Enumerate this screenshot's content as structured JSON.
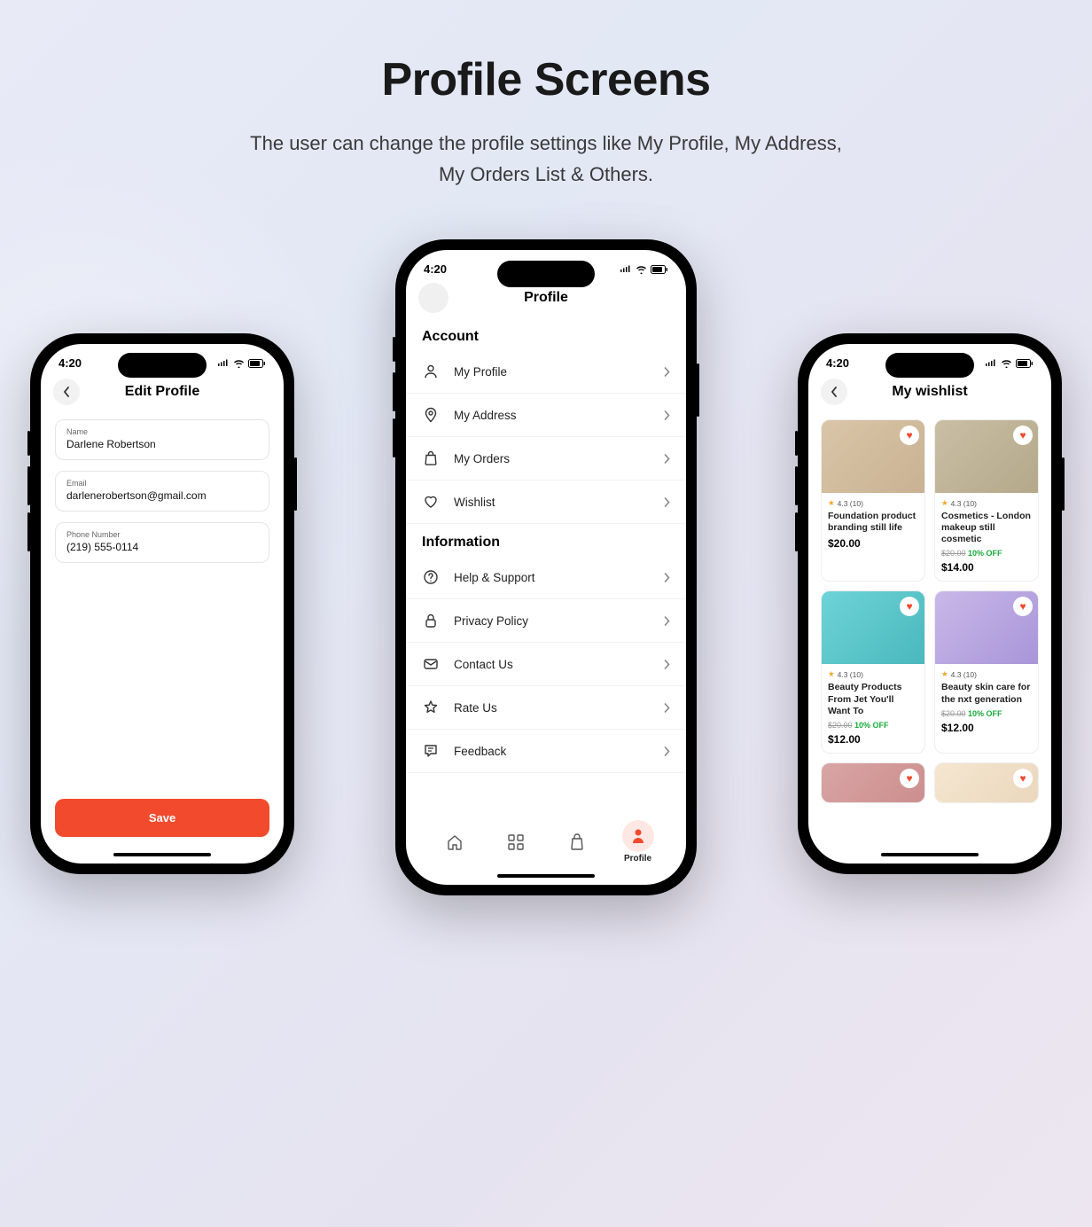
{
  "page": {
    "title": "Profile Screens",
    "subtitle": "The user can change the profile settings like My Profile, My Address, My Orders List & Others."
  },
  "status_time": "4:20",
  "edit_profile": {
    "title": "Edit Profile",
    "fields": {
      "name": {
        "label": "Name",
        "value": "Darlene Robertson"
      },
      "email": {
        "label": "Email",
        "value": "darlenerobertson@gmail.com"
      },
      "phone": {
        "label": "Phone Number",
        "value": "(219) 555-0114"
      }
    },
    "save": "Save"
  },
  "profile": {
    "title": "Profile",
    "sections": [
      {
        "heading": "Account",
        "items": [
          {
            "label": "My Profile",
            "icon": "user-icon"
          },
          {
            "label": "My Address",
            "icon": "location-icon"
          },
          {
            "label": "My Orders",
            "icon": "bag-icon"
          },
          {
            "label": "Wishlist",
            "icon": "heart-icon"
          }
        ]
      },
      {
        "heading": "Information",
        "items": [
          {
            "label": "Help & Support",
            "icon": "help-icon"
          },
          {
            "label": "Privacy Policy",
            "icon": "lock-icon"
          },
          {
            "label": "Contact Us",
            "icon": "mail-icon"
          },
          {
            "label": "Rate Us",
            "icon": "star-icon"
          },
          {
            "label": "Feedback",
            "icon": "feedback-icon"
          }
        ]
      }
    ],
    "bottom_nav": {
      "active_label": "Profile"
    }
  },
  "wishlist": {
    "title": "My wishlist",
    "products": [
      {
        "rating": "4.3 (10)",
        "title": "Foundation product branding still life",
        "old": "",
        "disc": "",
        "price": "$20.00",
        "bg": "linear-gradient(135deg,#d9c5a8,#c9b293)"
      },
      {
        "rating": "4.3 (10)",
        "title": "Cosmetics - London makeup still cosmetic",
        "old": "$20.00",
        "disc": "10% OFF",
        "price": "$14.00",
        "bg": "linear-gradient(135deg,#c9bfa5,#b5a88a)"
      },
      {
        "rating": "4.3 (10)",
        "title": "Beauty Products From Jet You'll Want To",
        "old": "$20.00",
        "disc": "10% OFF",
        "price": "$12.00",
        "bg": "linear-gradient(135deg,#6dd4d8,#4ab8bd)"
      },
      {
        "rating": "4.3 (10)",
        "title": "Beauty skin care for the nxt generation",
        "old": "$20.00",
        "disc": "10% OFF",
        "price": "$12.00",
        "bg": "linear-gradient(135deg,#c9b8e8,#a895d9)"
      },
      {
        "rating": "",
        "title": "",
        "old": "",
        "disc": "",
        "price": "",
        "bg": "linear-gradient(135deg,#d9a5a5,#c98888)",
        "partial": true
      },
      {
        "rating": "",
        "title": "",
        "old": "",
        "disc": "",
        "price": "",
        "bg": "linear-gradient(135deg,#f5e6d0,#e8d4b8)",
        "partial": true
      }
    ]
  }
}
